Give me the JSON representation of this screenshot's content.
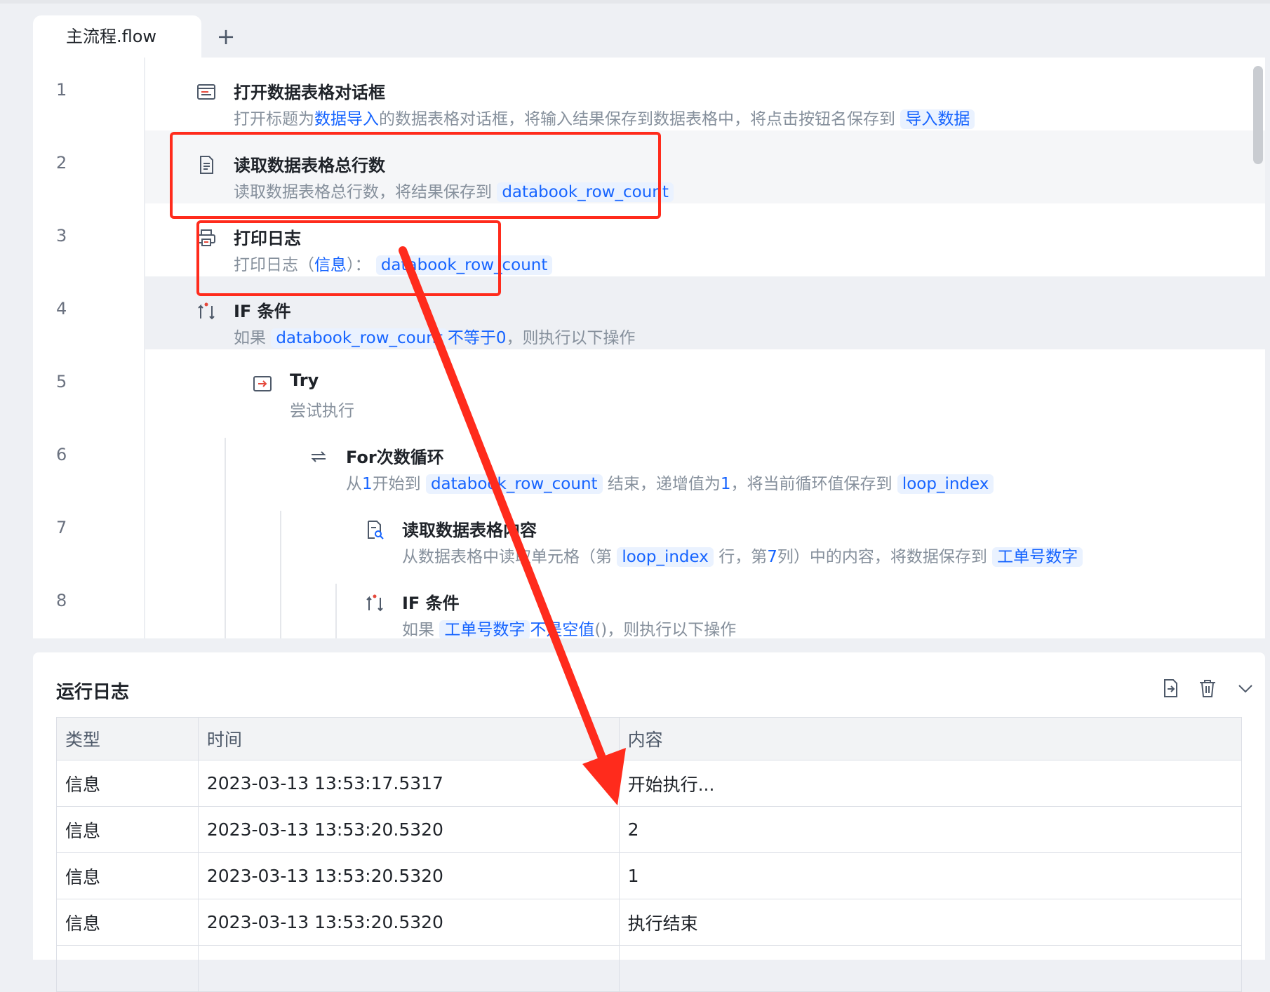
{
  "tab_bar": {
    "active_tab": "主流程.flow",
    "add_label": "+"
  },
  "editor": {
    "line_numbers": [
      "1",
      "2",
      "3",
      "4",
      "5",
      "6",
      "7",
      "8"
    ],
    "steps": [
      {
        "icon": "dialog-icon",
        "title": "打开数据表格对话框",
        "desc": {
          "p1": "打开标题为",
          "t1": "数据导入",
          "p2": "的数据表格对话框，将输入结果保存到数据表格中，将点击按钮名保存到",
          "t2": "导入数据"
        }
      },
      {
        "icon": "document-icon",
        "title": "读取数据表格总行数",
        "desc": {
          "p1": "读取数据表格总行数，将结果保存到",
          "t1": "databook_row_count"
        }
      },
      {
        "icon": "printer-icon",
        "title": "打印日志",
        "desc": {
          "p1": "打印日志（",
          "h1": "信息",
          "p2": "）：",
          "t1": "databook_row_count"
        }
      },
      {
        "icon": "condition-icon",
        "title": "IF 条件",
        "desc": {
          "p1": "如果",
          "t1": "databook_row_count",
          "h1": "不等于0",
          "p2": "，则执行以下操作"
        }
      },
      {
        "icon": "try-icon",
        "title": "Try",
        "desc": {
          "p1": "尝试执行"
        }
      },
      {
        "icon": "loop-icon",
        "title": "For次数循环",
        "desc": {
          "p1": "从",
          "h1": "1",
          "p2": "开始到",
          "t1": "databook_row_count",
          "p3": "结束，递增值为",
          "h2": "1",
          "p4": "，将当前循环值保存到",
          "t2": "loop_index"
        }
      },
      {
        "icon": "read-cell-icon",
        "title": "读取数据表格内容",
        "desc": {
          "p1": "从数据表格中读取单元格（第",
          "t1": "loop_index",
          "p2": "行，第",
          "h1": "7",
          "p3": "列）中的内容，将数据保存到",
          "t2": "工单号数字"
        }
      },
      {
        "icon": "condition-icon",
        "title": "IF 条件",
        "desc": {
          "p1": "如果",
          "t1": "工单号数字",
          "h1": "不是空值",
          "p2": "()，则执行以下操作"
        }
      }
    ]
  },
  "log": {
    "title": "运行日志",
    "tools": [
      "export-icon",
      "trash-icon",
      "chevron-down-icon"
    ],
    "columns": [
      "类型",
      "时间",
      "内容"
    ],
    "rows": [
      {
        "type": "信息",
        "time": "2023-03-13 13:53:17.5317",
        "content": "开始执行..."
      },
      {
        "type": "信息",
        "time": "2023-03-13 13:53:20.5320",
        "content": "2"
      },
      {
        "type": "信息",
        "time": "2023-03-13 13:53:20.5320",
        "content": "1"
      },
      {
        "type": "信息",
        "time": "2023-03-13 13:53:20.5320",
        "content": "执行结束"
      }
    ]
  },
  "colors": {
    "accent": "#1664ff",
    "annotation": "#ff2b1c"
  }
}
